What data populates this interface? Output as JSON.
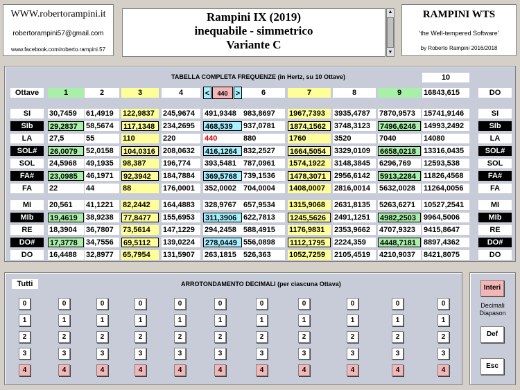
{
  "contact": {
    "site": "WWW.robertorampini.it",
    "email": "robertorampini57@gmail.com",
    "facebook": "www.facebook.com/roberto.rampini.57"
  },
  "title": {
    "line1": "Rampini IX (2019)",
    "line2": "inequabile - simmetrico",
    "line3": "Variante C"
  },
  "brand": {
    "name": "RAMPINI WTS",
    "tag": "'the Well-tempered Software'",
    "by": "by Roberto Rampini 2016/2018"
  },
  "table": {
    "title": "TABELLA COMPLETA FREQUENZE (in Hertz, su 10 Ottave)",
    "octaves_label": "Ottave",
    "top_value": "10",
    "octave_headers": [
      "1",
      "2",
      "3",
      "4",
      "440",
      "6",
      "7",
      "8",
      "9",
      "16843,615"
    ],
    "nav_prev": "<",
    "nav_next": ">",
    "do_header": "DO",
    "rows": [
      {
        "note": "SI",
        "dark": false,
        "values": [
          "30,7459",
          "61,4919",
          "122,9837",
          "245,9674",
          "491,9348",
          "983,8697",
          "1967,7393",
          "3935,4787",
          "7870,9573",
          "15741,9146"
        ]
      },
      {
        "note": "SIb",
        "dark": true,
        "values": [
          "29,2837",
          "58,5674",
          "117,1348",
          "234,2695",
          "468,539",
          "937,0781",
          "1874,1562",
          "3748,3123",
          "7496,6246",
          "14993,2492"
        ]
      },
      {
        "note": "LA",
        "dark": false,
        "values": [
          "27,5",
          "55",
          "110",
          "220",
          "440",
          "880",
          "1760",
          "3520",
          "7040",
          "14080"
        ]
      },
      {
        "note": "SOL#",
        "dark": true,
        "values": [
          "26,0079",
          "52,0158",
          "104,0316",
          "208,0632",
          "416,1264",
          "832,2527",
          "1664,5054",
          "3329,0109",
          "6658,0218",
          "13316,0435"
        ]
      },
      {
        "note": "SOL",
        "dark": false,
        "values": [
          "24,5968",
          "49,1935",
          "98,387",
          "196,774",
          "393,5481",
          "787,0961",
          "1574,1922",
          "3148,3845",
          "6296,769",
          "12593,538"
        ]
      },
      {
        "note": "FA#",
        "dark": true,
        "values": [
          "23,0985",
          "46,1971",
          "92,3942",
          "184,7884",
          "369,5768",
          "739,1536",
          "1478,3071",
          "2956,6142",
          "5913,2284",
          "11826,4568"
        ]
      },
      {
        "note": "FA",
        "dark": false,
        "values": [
          "22",
          "44",
          "88",
          "176,0001",
          "352,0002",
          "704,0004",
          "1408,0007",
          "2816,0014",
          "5632,0028",
          "11264,0056"
        ]
      },
      {
        "note": "MI",
        "dark": false,
        "values": [
          "20,561",
          "41,1221",
          "82,2442",
          "164,4883",
          "328,9767",
          "657,9534",
          "1315,9068",
          "2631,8135",
          "5263,6271",
          "10527,2541"
        ]
      },
      {
        "note": "MIb",
        "dark": true,
        "values": [
          "19,4619",
          "38,9238",
          "77,8477",
          "155,6953",
          "311,3906",
          "622,7813",
          "1245,5626",
          "2491,1251",
          "4982,2503",
          "9964,5006"
        ]
      },
      {
        "note": "RE",
        "dark": false,
        "values": [
          "18,3904",
          "36,7807",
          "73,5614",
          "147,1229",
          "294,2458",
          "588,4915",
          "1176,9831",
          "2353,9662",
          "4707,9323",
          "9415,8647"
        ]
      },
      {
        "note": "DO#",
        "dark": true,
        "values": [
          "17,3778",
          "34,7556",
          "69,5112",
          "139,0224",
          "278,0449",
          "556,0898",
          "1112,1795",
          "2224,359",
          "4448,7181",
          "8897,4362"
        ]
      },
      {
        "note": "DO",
        "dark": false,
        "values": [
          "16,4488",
          "32,8977",
          "65,7954",
          "131,5907",
          "263,1815",
          "526,363",
          "1052,7259",
          "2105,4519",
          "4210,9037",
          "8421,8075"
        ]
      }
    ]
  },
  "rounding": {
    "tutti": "Tutti",
    "title": "ARROTONDAMENTO DECIMALI (per ciascuna Ottava)",
    "digits": [
      "0",
      "1",
      "2",
      "3",
      "4"
    ]
  },
  "side": {
    "interi": "Interi",
    "decimali": "Decimali",
    "diapason": "Diapason",
    "def": "Def",
    "esc": "Esc"
  }
}
